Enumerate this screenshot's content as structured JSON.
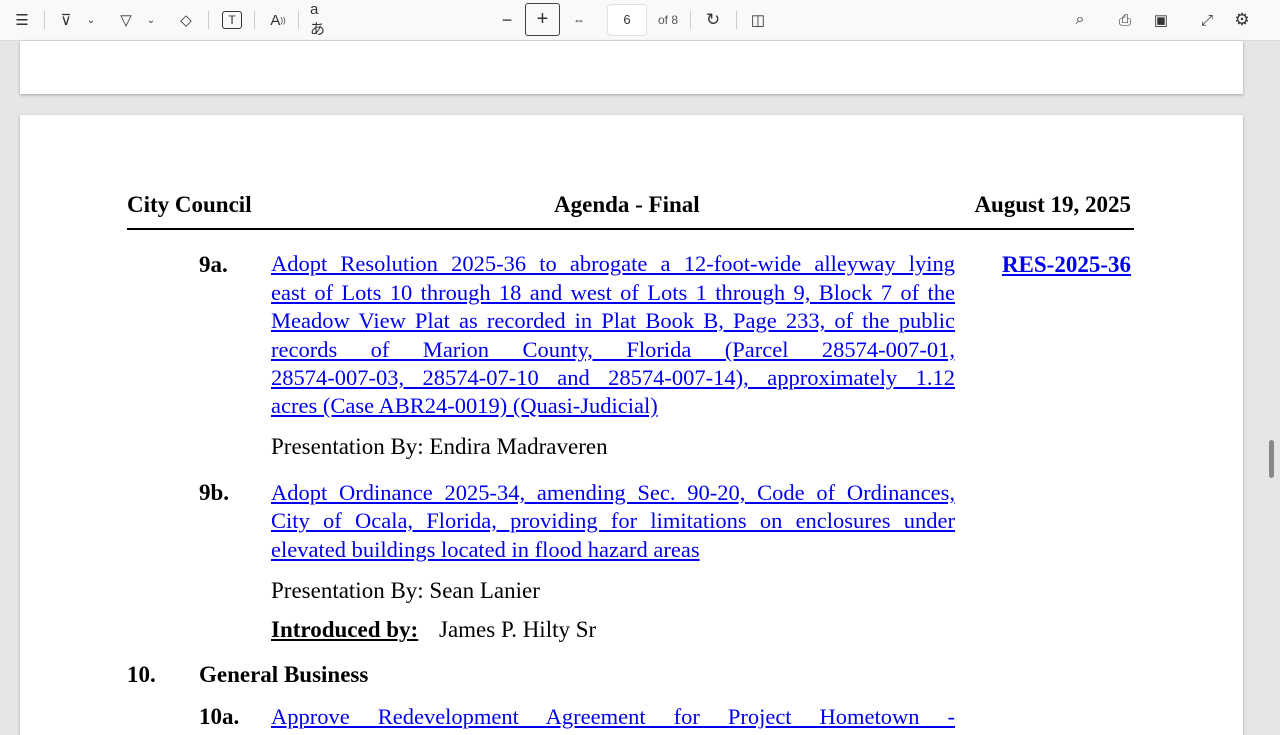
{
  "toolbar": {
    "page_current": "6",
    "page_total": "of 8",
    "icons": [
      "contents-icon",
      "highlight-icon",
      "draw-icon",
      "erase-icon",
      "text-box-icon",
      "read-aloud-icon",
      "translate-icon",
      "zoom-out-icon",
      "zoom-in-icon",
      "fit-width-icon",
      "rotate-icon",
      "page-view-icon",
      "search-icon",
      "print-icon",
      "save-icon",
      "fullscreen-icon",
      "settings-icon"
    ]
  },
  "header": {
    "left": "City Council",
    "center": "Agenda - Final",
    "right": "August 19, 2025"
  },
  "items": [
    {
      "num": "9a.",
      "lines": [
        "Adopt Resolution 2025-36 to abrogate a 12-foot-wide alleyway lying",
        "east of Lots 10 through 18 and west of Lots 1 through 9, Block 7 of the",
        "Meadow View Plat as recorded in Plat Book B, Page 233, of the public",
        "records of Marion County, Florida (Parcel 28574-007-01,",
        "28574-007-03, 28574-07-10 and 28574-007-14), approximately 1.12",
        "acres (Case ABR24-0019) (Quasi-Judicial)"
      ],
      "file": "RES-2025-36",
      "presentation": "Presentation By: Endira Madraveren"
    },
    {
      "num": "9b.",
      "lines": [
        "Adopt Ordinance 2025-34, amending Sec. 90-20, Code of Ordinances,",
        "City of Ocala, Florida, providing for limitations on enclosures under",
        "elevated buildings located in flood hazard areas"
      ],
      "presentation": "Presentation By: Sean Lanier",
      "introduced_label": "Introduced by:",
      "introduced_value": "James P. Hilty Sr"
    }
  ],
  "section": {
    "num": "10.",
    "title": "General Business"
  },
  "next_item": {
    "num": "10a.",
    "line": "Approve Redevelopment Agreement for Project Hometown -"
  }
}
